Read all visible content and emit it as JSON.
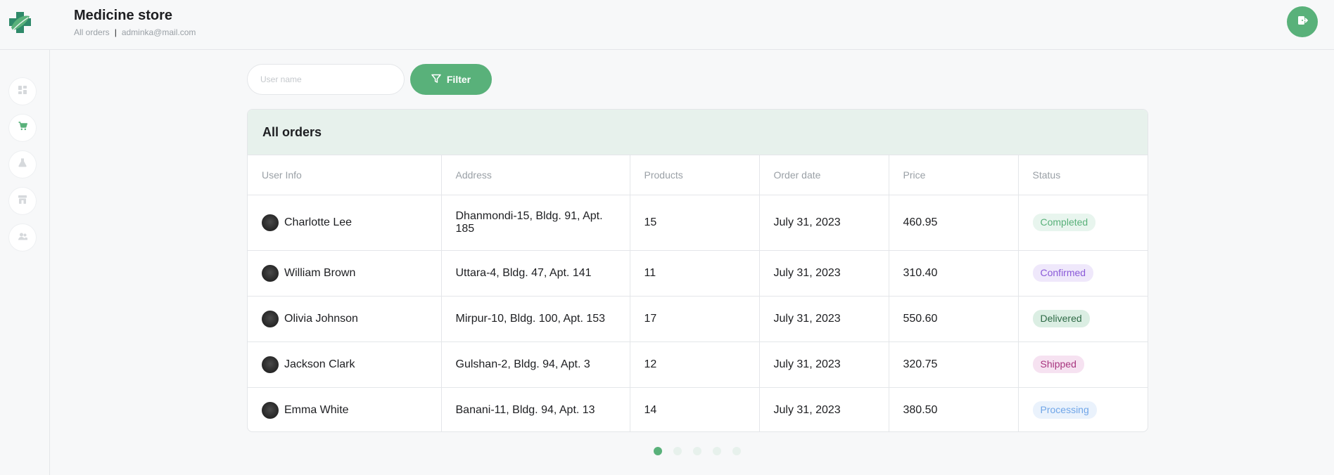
{
  "header": {
    "title": "Medicine store",
    "page_label": "All orders",
    "separator": "|",
    "user_email": "adminka@mail.com"
  },
  "sidebar": {
    "items": [
      {
        "icon": "dashboard-icon",
        "active": false
      },
      {
        "icon": "cart-icon",
        "active": true
      },
      {
        "icon": "flask-icon",
        "active": false
      },
      {
        "icon": "store-icon",
        "active": false
      },
      {
        "icon": "users-icon",
        "active": false
      }
    ]
  },
  "filter": {
    "placeholder": "User name",
    "button_label": "Filter"
  },
  "orders": {
    "title": "All orders",
    "columns": [
      "User Info",
      "Address",
      "Products",
      "Order date",
      "Price",
      "Status"
    ],
    "rows": [
      {
        "name": "Charlotte Lee",
        "address": "Dhanmondi-15, Bldg. 91, Apt. 185",
        "products": "15",
        "date": "July 31, 2023",
        "price": "460.95",
        "status": "Completed"
      },
      {
        "name": "William Brown",
        "address": "Uttara-4, Bldg. 47, Apt. 141",
        "products": "11",
        "date": "July 31, 2023",
        "price": "310.40",
        "status": "Confirmed"
      },
      {
        "name": "Olivia Johnson",
        "address": "Mirpur-10, Bldg. 100, Apt. 153",
        "products": "17",
        "date": "July 31, 2023",
        "price": "550.60",
        "status": "Delivered"
      },
      {
        "name": "Jackson Clark",
        "address": "Gulshan-2, Bldg. 94, Apt. 3",
        "products": "12",
        "date": "July 31, 2023",
        "price": "320.75",
        "status": "Shipped"
      },
      {
        "name": "Emma White",
        "address": "Banani-11, Bldg. 94, Apt. 13",
        "products": "14",
        "date": "July 31, 2023",
        "price": "380.50",
        "status": "Processing"
      }
    ]
  },
  "status_colors": {
    "Completed": {
      "bg": "#e8f5ee",
      "fg": "#59b17a"
    },
    "Confirmed": {
      "bg": "#efe8fb",
      "fg": "#8a5ad8"
    },
    "Delivered": {
      "bg": "#dbeee3",
      "fg": "#2e6a46"
    },
    "Shipped": {
      "bg": "#f6e2f1",
      "fg": "#a8357f"
    },
    "Processing": {
      "bg": "#eaf2fc",
      "fg": "#70a6e8"
    }
  },
  "pagination": {
    "pages": 5,
    "current": 1
  },
  "colors": {
    "accent": "#59b17a",
    "header_bg": "#e7f1ec"
  }
}
